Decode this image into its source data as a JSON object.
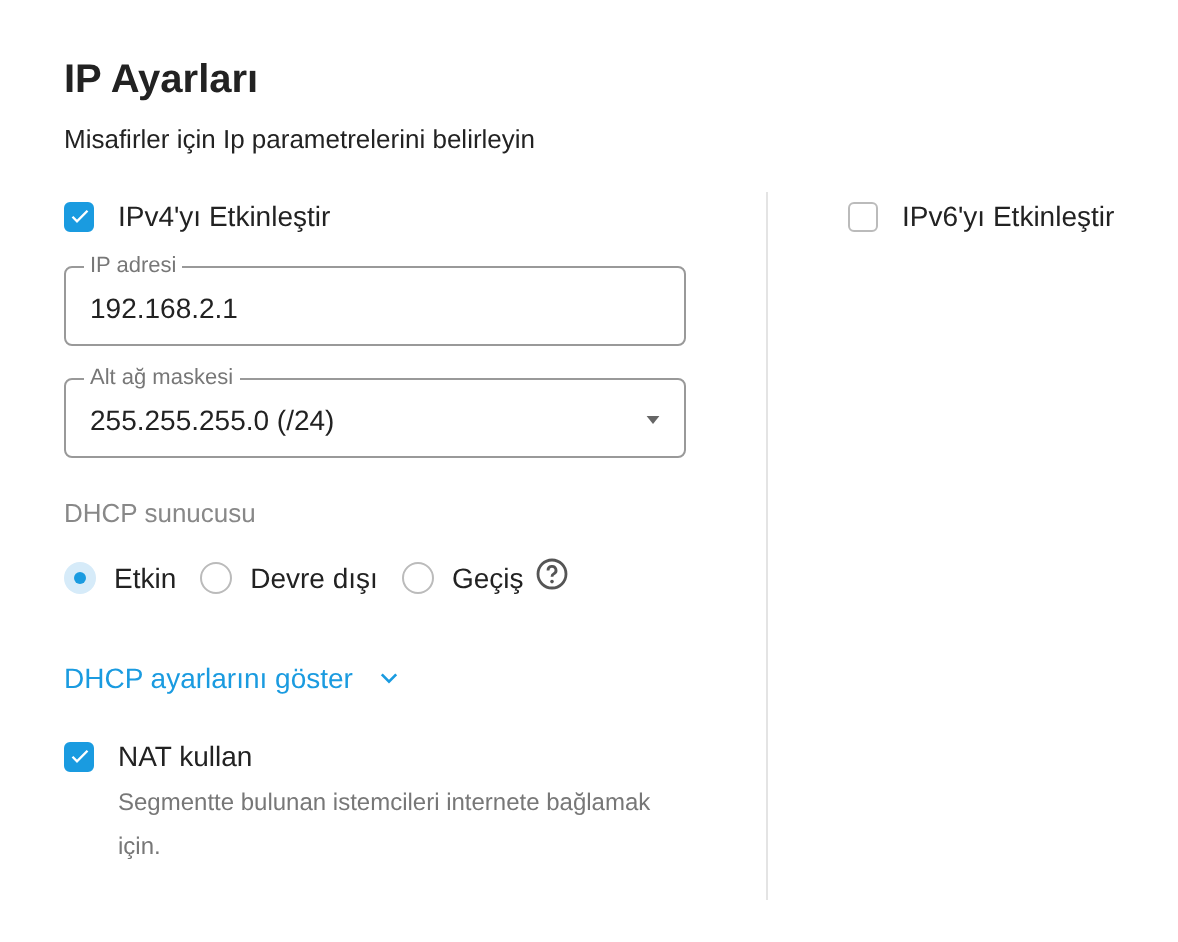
{
  "title": "IP Ayarları",
  "subtitle": "Misafirler için Ip parametrelerini belirleyin",
  "ipv4": {
    "label": "IPv4'yı Etkinleştir",
    "checked": true
  },
  "ipv6": {
    "label": "IPv6'yı Etkinleştir",
    "checked": false
  },
  "fields": [
    {
      "kind": "text",
      "label": "IP adresi",
      "value": "192.168.2.1"
    },
    {
      "kind": "select",
      "label": "Alt ağ maskesi",
      "value": "255.255.255.0 (/24)"
    }
  ],
  "dhcp": {
    "label": "DHCP sunucusu",
    "options": [
      {
        "label": "Etkin",
        "selected": true
      },
      {
        "label": "Devre dışı",
        "selected": false
      },
      {
        "label": "Geçiş",
        "selected": false
      }
    ]
  },
  "dhcp_link": {
    "label": "DHCP ayarlarını göster",
    "expanded": false
  },
  "nat": {
    "label": "NAT kullan",
    "checked": true,
    "description": "Segmentte bulunan istemcileri internete bağlamak için."
  }
}
